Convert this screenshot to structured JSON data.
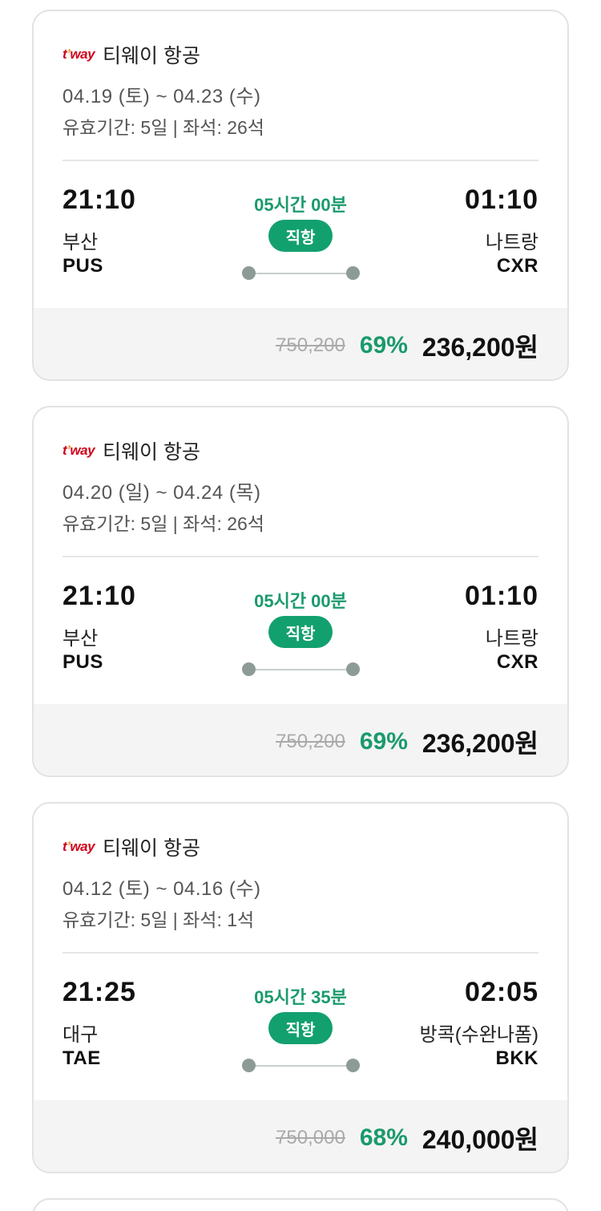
{
  "flights": [
    {
      "airline": "티웨이 항공",
      "logo": {
        "t": "t",
        "apos": "’",
        "way": "way"
      },
      "dates": "04.19 (토) ~ 04.23 (수)",
      "validity": "유효기간: 5일 | 좌석: 26석",
      "dep_time": "21:10",
      "dep_city": "부산",
      "dep_code": "PUS",
      "duration": "05시간 00분",
      "type": "직항",
      "arr_time": "01:10",
      "arr_city": "나트랑",
      "arr_code": "CXR",
      "orig_price": "750,200",
      "discount": "69%",
      "final_price": "236,200원"
    },
    {
      "airline": "티웨이 항공",
      "logo": {
        "t": "t",
        "apos": "’",
        "way": "way"
      },
      "dates": "04.20 (일) ~ 04.24 (목)",
      "validity": "유효기간: 5일 | 좌석: 26석",
      "dep_time": "21:10",
      "dep_city": "부산",
      "dep_code": "PUS",
      "duration": "05시간 00분",
      "type": "직항",
      "arr_time": "01:10",
      "arr_city": "나트랑",
      "arr_code": "CXR",
      "orig_price": "750,200",
      "discount": "69%",
      "final_price": "236,200원"
    },
    {
      "airline": "티웨이 항공",
      "logo": {
        "t": "t",
        "apos": "’",
        "way": "way"
      },
      "dates": "04.12 (토) ~ 04.16 (수)",
      "validity": "유효기간: 5일 | 좌석: 1석",
      "dep_time": "21:25",
      "dep_city": "대구",
      "dep_code": "TAE",
      "duration": "05시간 35분",
      "type": "직항",
      "arr_time": "02:05",
      "arr_city": "방콕(수완나폼)",
      "arr_code": "BKK",
      "orig_price": "750,000",
      "discount": "68%",
      "final_price": "240,000원"
    }
  ],
  "colors": {
    "accent_green": "#1a9a6c",
    "badge_green": "#13a06f",
    "logo_red": "#d0021b"
  }
}
